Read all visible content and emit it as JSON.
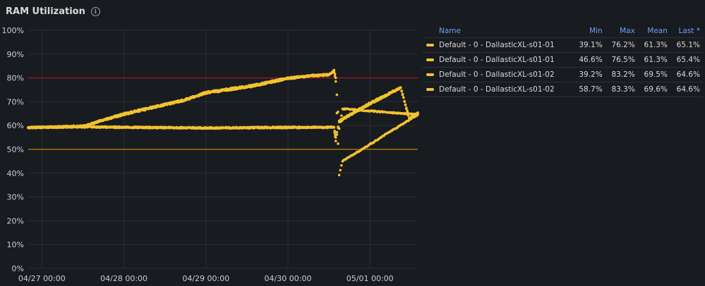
{
  "panel": {
    "title": "RAM Utilization",
    "info_icon": "info-circle-icon"
  },
  "colors": {
    "series": "#f2c230",
    "threshold_high": "#c4162a",
    "threshold_mid": "#e0a400",
    "grid": "#2b2e33",
    "text": "#ccccdc"
  },
  "chart_data": {
    "type": "scatter",
    "title": "RAM Utilization",
    "ylim": [
      0,
      100
    ],
    "y_ticks": [
      "0%",
      "10%",
      "20%",
      "30%",
      "40%",
      "50%",
      "60%",
      "70%",
      "80%",
      "90%",
      "100%"
    ],
    "y_tick_values": [
      0,
      10,
      20,
      30,
      40,
      50,
      60,
      70,
      80,
      90,
      100
    ],
    "x_range": [
      "2026-04-26T20:00",
      "2026-05-01T14:00"
    ],
    "x_ticks": [
      "04/27 00:00",
      "04/28 00:00",
      "04/29 00:00",
      "04/30 00:00",
      "05/01 00:00"
    ],
    "x_tick_values": [
      "2026-04-27T00:00",
      "2026-04-28T00:00",
      "2026-04-29T00:00",
      "2026-04-30T00:00",
      "2026-05-01T00:00"
    ],
    "grid": true,
    "legend_position": "right",
    "thresholds": [
      {
        "value": 80,
        "color": "#c4162a"
      },
      {
        "value": 50,
        "color": "#e0a400"
      }
    ],
    "series": [
      {
        "name": "Default - 0 - DallasticXL-s01-01",
        "points": [
          [
            "2026-04-26T20:00",
            59.2
          ],
          [
            "2026-04-27T12:00",
            59.5
          ],
          [
            "2026-04-28T00:00",
            59.3
          ],
          [
            "2026-04-29T00:00",
            59.0
          ],
          [
            "2026-04-30T00:00",
            59.3
          ],
          [
            "2026-04-30T13:30",
            59.3
          ],
          [
            "2026-04-30T14:00",
            55.0
          ],
          [
            "2026-04-30T15:00",
            62.0
          ],
          [
            "2026-04-30T18:00",
            64.5
          ],
          [
            "2026-05-01T00:00",
            69.5
          ],
          [
            "2026-05-01T09:00",
            76.0
          ],
          [
            "2026-05-01T11:30",
            62.8
          ],
          [
            "2026-05-01T14:00",
            65.1
          ]
        ]
      },
      {
        "name": "Default - 0 - DallasticXL-s01-01",
        "points": [
          [
            "2026-04-26T20:00",
            59.1
          ],
          [
            "2026-04-27T12:00",
            59.4
          ],
          [
            "2026-04-28T00:00",
            59.2
          ],
          [
            "2026-04-29T00:00",
            58.9
          ],
          [
            "2026-04-30T00:00",
            59.1
          ],
          [
            "2026-04-30T13:30",
            59.2
          ],
          [
            "2026-04-30T14:00",
            53.5
          ],
          [
            "2026-04-30T15:00",
            61.5
          ],
          [
            "2026-04-30T18:00",
            64.2
          ],
          [
            "2026-05-01T00:00",
            69.0
          ],
          [
            "2026-05-01T09:00",
            75.8
          ],
          [
            "2026-05-01T11:30",
            63.2
          ],
          [
            "2026-05-01T14:00",
            65.4
          ]
        ]
      },
      {
        "name": "Default - 0 - DallasticXL-s01-02",
        "points": [
          [
            "2026-04-26T20:00",
            59.2
          ],
          [
            "2026-04-27T12:00",
            59.8
          ],
          [
            "2026-04-28T00:00",
            65.0
          ],
          [
            "2026-04-28T18:00",
            71.0
          ],
          [
            "2026-04-29T00:00",
            74.0
          ],
          [
            "2026-04-29T12:00",
            76.5
          ],
          [
            "2026-04-30T00:00",
            80.0
          ],
          [
            "2026-04-30T06:00",
            81.0
          ],
          [
            "2026-04-30T12:00",
            81.5
          ],
          [
            "2026-04-30T13:30",
            82.5
          ],
          [
            "2026-04-30T14:00",
            78.5
          ],
          [
            "2026-04-30T15:00",
            39.2
          ],
          [
            "2026-04-30T16:00",
            45.0
          ],
          [
            "2026-05-01T14:00",
            64.6
          ]
        ]
      },
      {
        "name": "Default - 0 - DallasticXL-s01-02",
        "points": [
          [
            "2026-04-26T20:00",
            59.0
          ],
          [
            "2026-04-27T12:00",
            59.6
          ],
          [
            "2026-04-28T00:00",
            64.6
          ],
          [
            "2026-04-28T18:00",
            70.6
          ],
          [
            "2026-04-29T00:00",
            73.6
          ],
          [
            "2026-04-29T12:00",
            76.0
          ],
          [
            "2026-04-30T00:00",
            79.6
          ],
          [
            "2026-04-30T06:00",
            80.7
          ],
          [
            "2026-04-30T12:00",
            81.2
          ],
          [
            "2026-04-30T13:30",
            83.3
          ],
          [
            "2026-04-30T14:00",
            80.0
          ],
          [
            "2026-04-30T15:00",
            58.7
          ],
          [
            "2026-04-30T16:00",
            67.0
          ],
          [
            "2026-05-01T14:00",
            64.6
          ]
        ]
      }
    ]
  },
  "legend": {
    "headers": [
      "Name",
      "Min",
      "Max",
      "Mean",
      "Last *"
    ],
    "rows": [
      {
        "name": "Default - 0 - DallasticXL-s01-01",
        "min": "39.1%",
        "max": "76.2%",
        "mean": "61.3%",
        "last": "65.1%"
      },
      {
        "name": "Default - 0 - DallasticXL-s01-01",
        "min": "46.6%",
        "max": "76.5%",
        "mean": "61.3%",
        "last": "65.4%"
      },
      {
        "name": "Default - 0 - DallasticXL-s01-02",
        "min": "39.2%",
        "max": "83.2%",
        "mean": "69.5%",
        "last": "64.6%"
      },
      {
        "name": "Default - 0 - DallasticXL-s01-02",
        "min": "58.7%",
        "max": "83.3%",
        "mean": "69.6%",
        "last": "64.6%"
      }
    ]
  }
}
